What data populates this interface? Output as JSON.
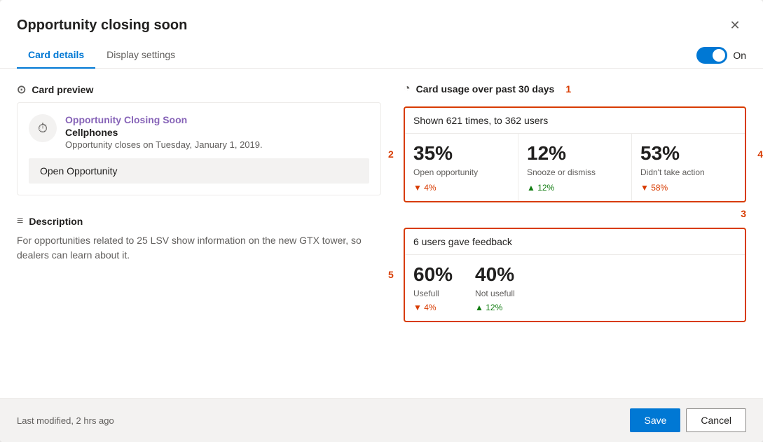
{
  "dialog": {
    "title": "Opportunity closing soon",
    "close_label": "✕"
  },
  "tabs": {
    "card_details": "Card details",
    "display_settings": "Display settings",
    "active": "card_details"
  },
  "toggle": {
    "label": "On",
    "on": true
  },
  "card_preview": {
    "section_label": "Card preview",
    "opportunity_title": "Opportunity Closing Soon",
    "company": "Cellphones",
    "closes_text": "Opportunity closes on Tuesday, January 1, 2019.",
    "action_button": "Open Opportunity"
  },
  "description": {
    "label": "Description",
    "text": "For opportunities related to 25 LSV show information on the new GTX tower, so dealers can learn about it."
  },
  "usage": {
    "section_label": "Card usage over past 30 days",
    "annotation_1": "1",
    "shown_text": "Shown 621 times, to 362 users",
    "metrics": [
      {
        "percent": "35%",
        "label": "Open opportunity",
        "delta": "▼ 4%",
        "delta_dir": "down"
      },
      {
        "percent": "12%",
        "label": "Snooze or dismiss",
        "delta": "▲ 12%",
        "delta_dir": "up"
      },
      {
        "percent": "53%",
        "label": "Didn't take action",
        "delta": "▼ 58%",
        "delta_dir": "down"
      }
    ],
    "annotation_2": "2",
    "annotation_4": "4",
    "annotation_3": "3"
  },
  "feedback": {
    "header": "6 users gave feedback",
    "metrics": [
      {
        "percent": "60%",
        "label": "Usefull",
        "delta": "▼ 4%",
        "delta_dir": "down"
      },
      {
        "percent": "40%",
        "label": "Not usefull",
        "delta": "▲ 12%",
        "delta_dir": "up"
      }
    ],
    "annotation_5": "5"
  },
  "footer": {
    "modified_text": "Last modified, 2 hrs ago",
    "save_label": "Save",
    "cancel_label": "Cancel"
  }
}
